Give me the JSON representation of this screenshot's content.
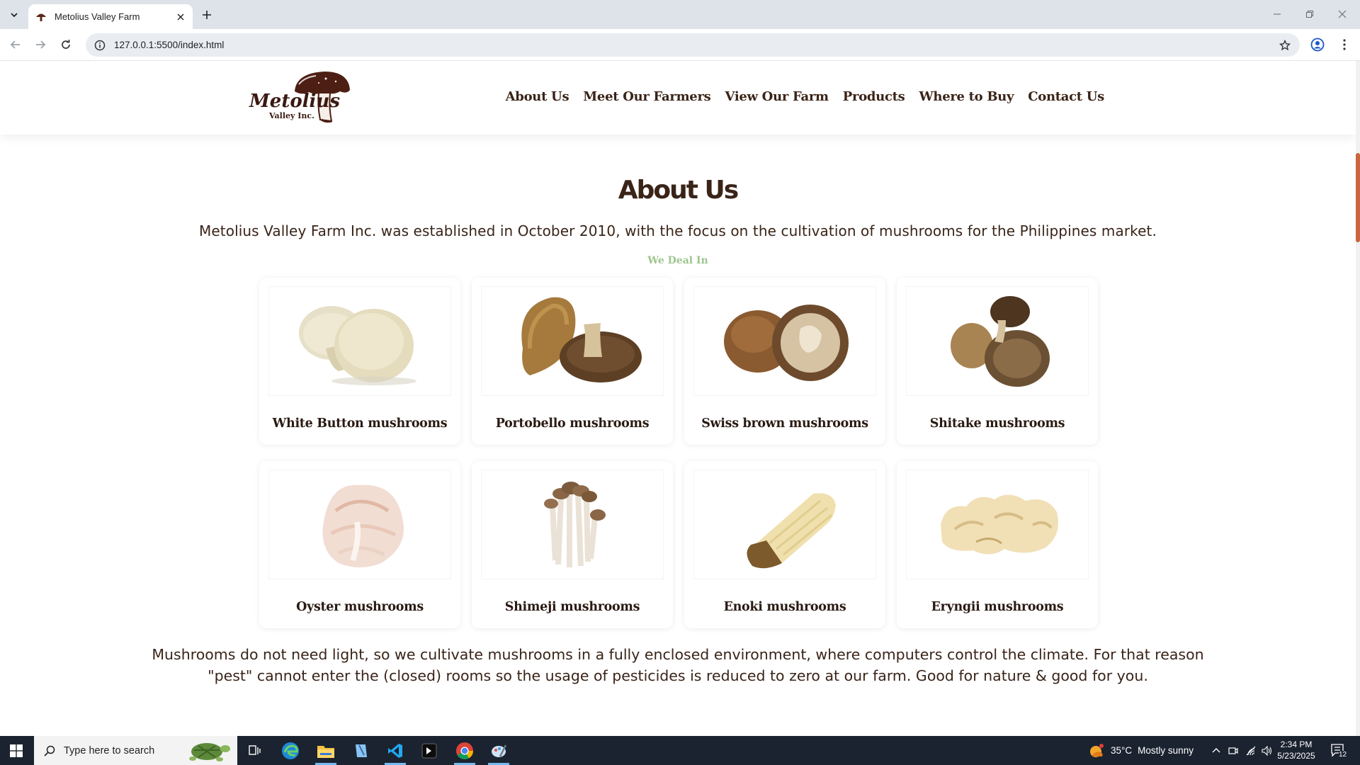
{
  "browser": {
    "tab_title": "Metolius Valley Farm",
    "url": "127.0.0.1:5500/index.html"
  },
  "site": {
    "logo": {
      "line1": "Metolius",
      "line2": "Valley Inc."
    },
    "nav": [
      {
        "label": "About Us"
      },
      {
        "label": "Meet Our Farmers"
      },
      {
        "label": "View Our Farm"
      },
      {
        "label": "Products"
      },
      {
        "label": "Where to Buy"
      },
      {
        "label": "Contact Us"
      }
    ]
  },
  "about": {
    "title": "About Us",
    "intro": "Metolius Valley Farm Inc. was established in October 2010, with the focus on the cultivation of mushrooms for the Philippines market.",
    "subheading": "We Deal In",
    "products": [
      {
        "name": "White Button mushrooms",
        "image": "white-button-mushroom-image"
      },
      {
        "name": "Portobello mushrooms",
        "image": "portobello-mushroom-image"
      },
      {
        "name": "Swiss brown mushrooms",
        "image": "swiss-brown-mushroom-image"
      },
      {
        "name": "Shitake mushrooms",
        "image": "shitake-mushroom-image"
      },
      {
        "name": "Oyster mushrooms",
        "image": "oyster-mushroom-image"
      },
      {
        "name": "Shimeji mushrooms",
        "image": "shimeji-mushroom-image"
      },
      {
        "name": "Enoki mushrooms",
        "image": "enoki-mushroom-image"
      },
      {
        "name": "Eryngii mushrooms",
        "image": "eryngii-mushroom-image"
      }
    ],
    "outro": "Mushrooms do not need light, so we cultivate mushrooms in a fully enclosed environment, where computers control the climate. For that reason \"pest\" cannot enter the (closed) rooms so the usage of pesticides is reduced to zero at our farm. Good for nature & good for you."
  },
  "taskbar": {
    "search_placeholder": "Type here to search",
    "weather": {
      "temp": "35°C",
      "condition": "Mostly sunny"
    },
    "clock": {
      "time": "2:34 PM",
      "date": "5/23/2025"
    },
    "notification_count": "12"
  },
  "colors": {
    "brand_brown": "#3a2418",
    "accent_green": "#9ec58e",
    "scroll_accent": "#c9653f"
  }
}
